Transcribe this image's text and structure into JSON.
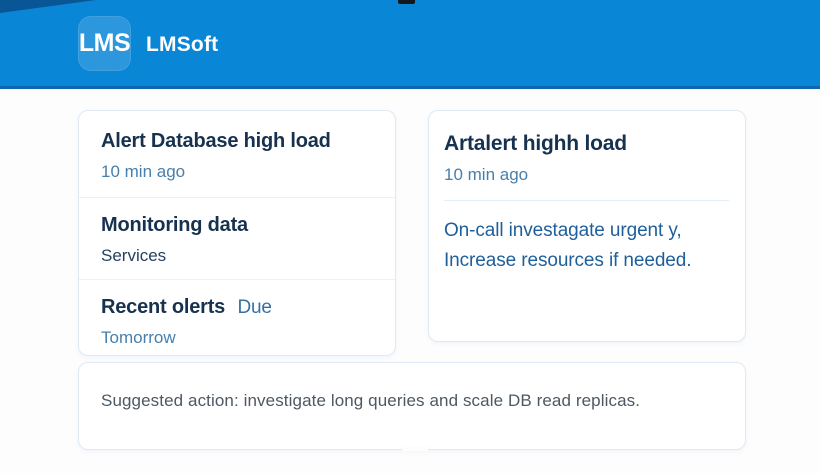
{
  "header": {
    "logo_text": "LMS",
    "brand": "LMSoft"
  },
  "alert_list": {
    "items": [
      {
        "title": "Alert Database high load",
        "suffix": "",
        "subtitle": "10 min ago"
      },
      {
        "title": "Monitoring data",
        "suffix": "",
        "subtitle": "Services"
      },
      {
        "title": "Recent olerts",
        "suffix": "Due",
        "subtitle": "Tomorrow"
      }
    ]
  },
  "alert_detail": {
    "title": "Artalert highh load",
    "timestamp": "10 min ago",
    "body": [
      "On-call investagate urgent y,",
      "Increase resources if needed."
    ]
  },
  "suggestion": {
    "text": "Suggested action: investigate long queries and scale DB read replicas."
  },
  "colors": {
    "header_blue": "#0a86d7",
    "header_edge": "#0e66b0",
    "title_navy": "#17324f",
    "body_blue": "#1e5f9b",
    "muted_blue": "#4780ac",
    "dark_sub": "#24415f",
    "suffix_blue": "#3470a6",
    "text_gray": "#4d5863",
    "card_border": "#dfe9f4",
    "page_bg": "#fdfdfe"
  }
}
